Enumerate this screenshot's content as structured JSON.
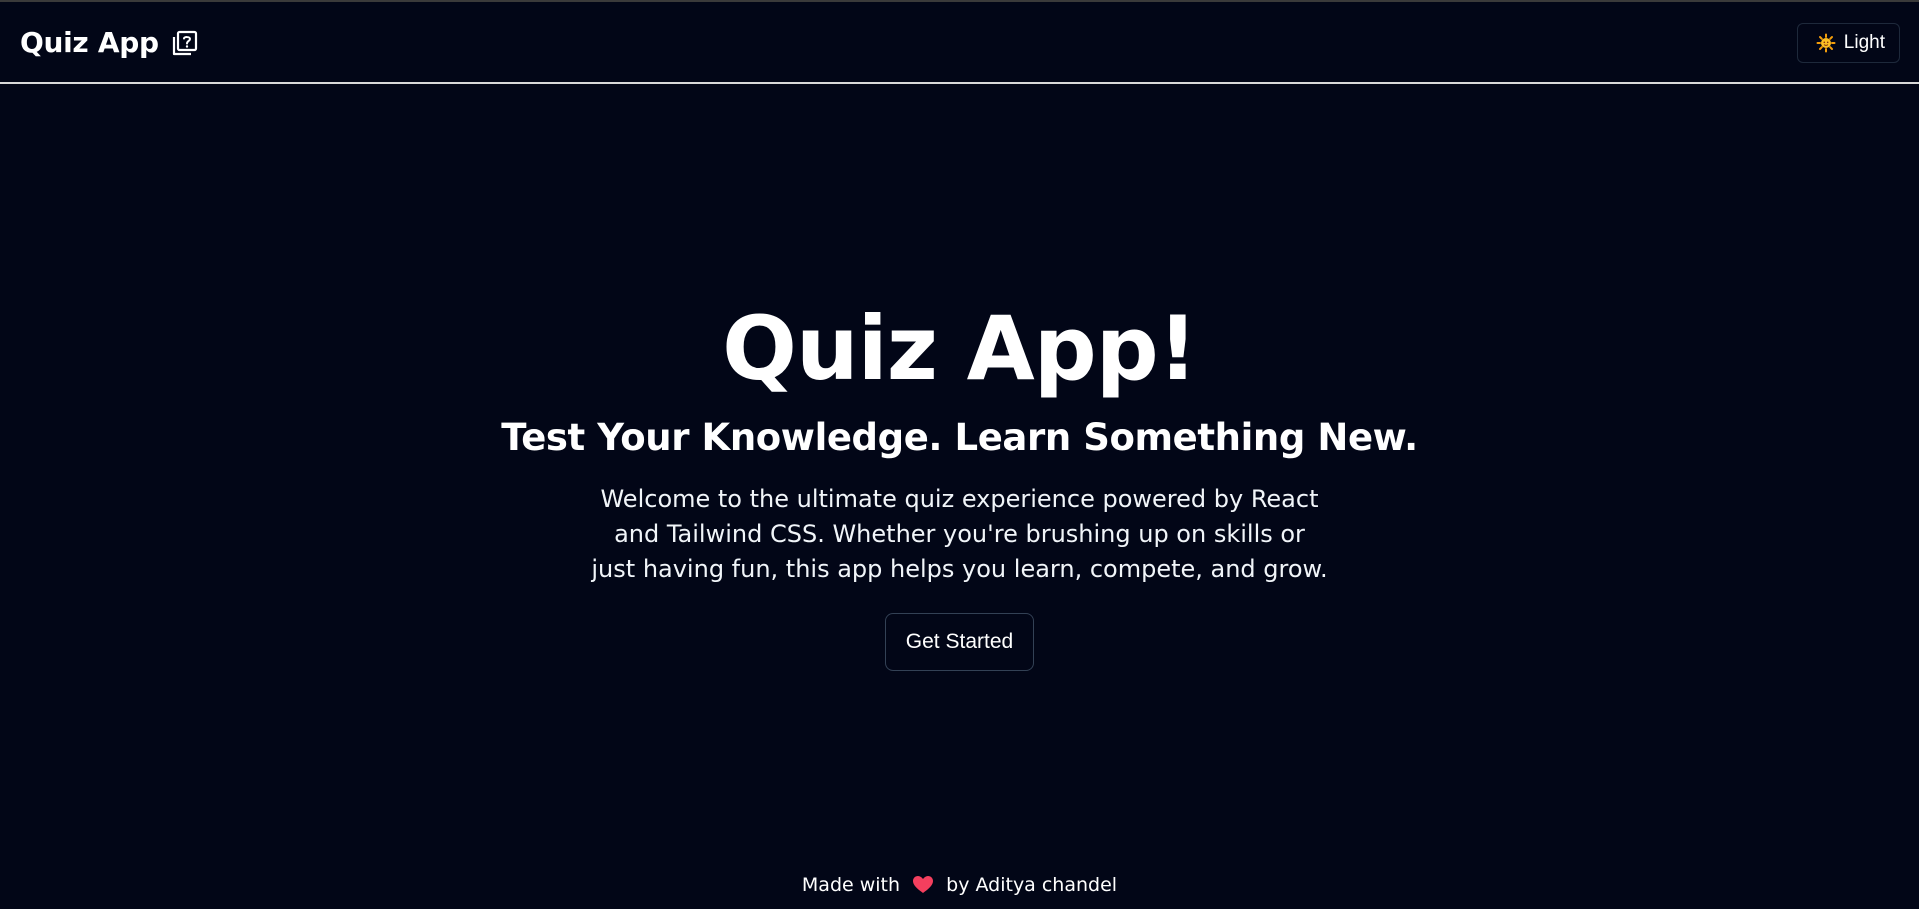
{
  "navbar": {
    "brand_title": "Quiz App",
    "brand_icon": "quiz-box-icon",
    "theme_toggle": {
      "icon": "sun-icon",
      "label": "Light"
    }
  },
  "hero": {
    "title": "Quiz App!",
    "subtitle": "Test Your Knowledge. Learn Something New.",
    "description": "Welcome to the ultimate quiz experience powered by React and Tailwind CSS. Whether you're brushing up on skills or just having fun, this app helps you learn, compete, and grow.",
    "cta_label": "Get Started"
  },
  "footer": {
    "prefix": "Made with",
    "icon": "heart-icon",
    "suffix": "by Aditya chandel"
  },
  "colors": {
    "background": "#020617",
    "text": "#ffffff",
    "navbar_border": "#d9d9d9",
    "heart": "#f43f5e",
    "sun": "#f59e0b"
  }
}
